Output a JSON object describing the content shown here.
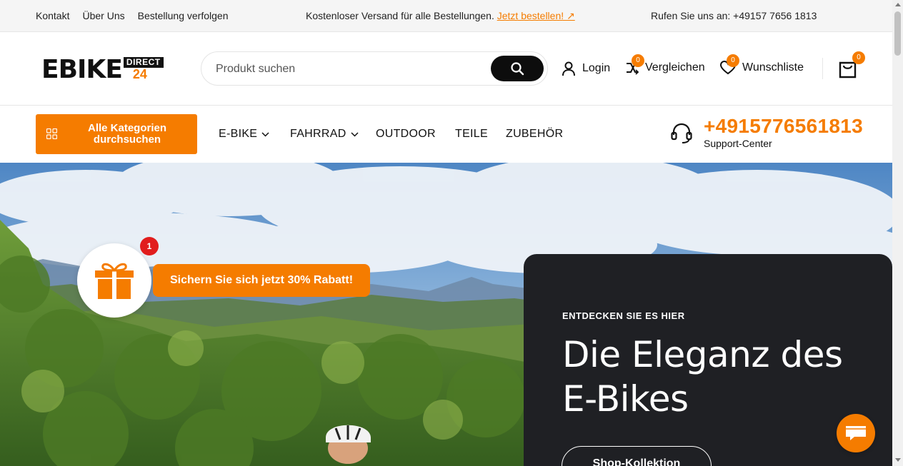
{
  "topbar": {
    "links": [
      "Kontakt",
      "Über Uns",
      "Bestellung verfolgen"
    ],
    "shipping_text": "Kostenloser Versand für alle Bestellungen.",
    "shipping_link": "Jetzt bestellen! ↗",
    "phone_text": "Rufen Sie uns an: +49157 7656 1813"
  },
  "header": {
    "logo_main": "EBIKE",
    "logo_badge": "DIRECT",
    "logo_number": "24",
    "search_placeholder": "Produkt suchen",
    "login": "Login",
    "compare": "Vergleichen",
    "compare_count": "0",
    "wishlist": "Wunschliste",
    "wishlist_count": "0",
    "cart_count": "0"
  },
  "nav": {
    "categories_button": "Alle Kategorien durchsuchen",
    "items": [
      {
        "label": "E-BIKE",
        "dropdown": true
      },
      {
        "label": "FAHRRAD",
        "dropdown": true
      },
      {
        "label": "OUTDOOR",
        "dropdown": false
      },
      {
        "label": "TEILE",
        "dropdown": false
      },
      {
        "label": "ZUBEHÖR",
        "dropdown": false
      }
    ],
    "support_phone": "+4915776561813",
    "support_label": "Support-Center"
  },
  "hero": {
    "promo_text": "Sichern Sie sich jetzt 30% Rabatt!",
    "promo_badge": "1",
    "kicker": "ENTDECKEN SIE ES HIER",
    "title": "Die Eleganz des E-Bikes",
    "cta": "Shop-Kollektion"
  },
  "colors": {
    "accent": "#f57c00",
    "dark_panel": "#1f2024",
    "notification": "#e11d1d"
  }
}
